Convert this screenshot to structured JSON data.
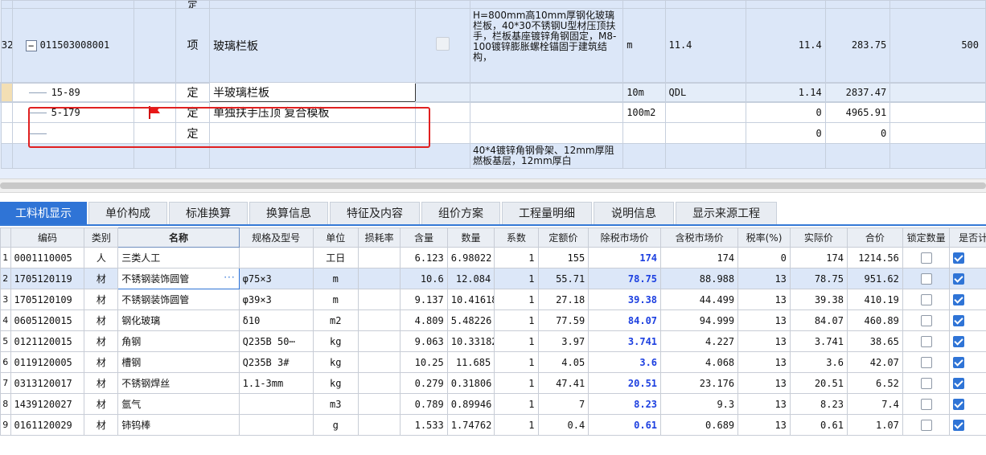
{
  "top_grid": {
    "partial_top_row": {
      "type": "定"
    },
    "main_row": {
      "rownum": "32",
      "code": "011503008001",
      "type": "项",
      "name": "玻璃栏板",
      "description": "H=800mm高10mm厚钢化玻璃栏板，40*30不锈钢U型材压顶扶手，栏板基座镀锌角钢固定，M8-100镀锌膨胀螺栓锚固于建筑结构，",
      "unit": "m",
      "qty_expr": "11.4",
      "qty": "11.4",
      "price": "283.75",
      "total": "500"
    },
    "selected_row": {
      "code": "15-89",
      "type": "定",
      "name": "半玻璃栏板",
      "unit": "10m",
      "qty_expr": "QDL",
      "qty": "1.14",
      "price": "2837.47"
    },
    "sub_rows": [
      {
        "code": "5-179",
        "type": "定",
        "name": "单独扶手压顶 复合模板",
        "unit": "100m2",
        "qty": "0",
        "price": "4965.91",
        "flagged": true
      },
      {
        "code": "",
        "type": "定",
        "name": "",
        "unit": "",
        "qty": "0",
        "price": "0",
        "flagged": false
      }
    ],
    "partial_bottom_row": {
      "description": "40*4镀锌角钢骨架、12mm厚阻燃板基层，12mm厚白"
    }
  },
  "tabs": [
    {
      "label": "工料机显示",
      "active": true
    },
    {
      "label": "单价构成",
      "active": false
    },
    {
      "label": "标准换算",
      "active": false
    },
    {
      "label": "换算信息",
      "active": false
    },
    {
      "label": "特征及内容",
      "active": false
    },
    {
      "label": "组价方案",
      "active": false
    },
    {
      "label": "工程量明细",
      "active": false
    },
    {
      "label": "说明信息",
      "active": false
    },
    {
      "label": "显示来源工程",
      "active": false
    }
  ],
  "bottom_grid": {
    "headers": [
      "编码",
      "类别",
      "名称",
      "规格及型号",
      "单位",
      "损耗率",
      "含量",
      "数量",
      "系数",
      "定额价",
      "除税市场价",
      "含税市场价",
      "税率(%)",
      "实际价",
      "合价",
      "锁定数量",
      "是否计"
    ],
    "rows": [
      {
        "rownum": "1",
        "code": "0001110005",
        "cat": "人",
        "name": "三类人工",
        "spec": "",
        "unit": "工日",
        "loss": "",
        "content": "6.123",
        "amount": "6.98022",
        "coef": "1",
        "quota": "155",
        "ex_tax": "174",
        "in_tax": "174",
        "tax": "0",
        "actual": "174",
        "total": "1214.56",
        "locked": false,
        "counted": true
      },
      {
        "rownum": "2",
        "code": "1705120119",
        "cat": "材",
        "name": "不锈钢装饰圆管",
        "spec": "φ75×3",
        "unit": "m",
        "loss": "",
        "content": "10.6",
        "amount": "12.084",
        "coef": "1",
        "quota": "55.71",
        "ex_tax": "78.75",
        "in_tax": "88.988",
        "tax": "13",
        "actual": "78.75",
        "total": "951.62",
        "locked": false,
        "counted": true,
        "selected": true
      },
      {
        "rownum": "3",
        "code": "1705120109",
        "cat": "材",
        "name": "不锈钢装饰圆管",
        "spec": "φ39×3",
        "unit": "m",
        "loss": "",
        "content": "9.137",
        "amount": "10.41618",
        "coef": "1",
        "quota": "27.18",
        "ex_tax": "39.38",
        "in_tax": "44.499",
        "tax": "13",
        "actual": "39.38",
        "total": "410.19",
        "locked": false,
        "counted": true
      },
      {
        "rownum": "4",
        "code": "0605120015",
        "cat": "材",
        "name": "钢化玻璃",
        "spec": "δ10",
        "unit": "m2",
        "loss": "",
        "content": "4.809",
        "amount": "5.48226",
        "coef": "1",
        "quota": "77.59",
        "ex_tax": "84.07",
        "in_tax": "94.999",
        "tax": "13",
        "actual": "84.07",
        "total": "460.89",
        "locked": false,
        "counted": true
      },
      {
        "rownum": "5",
        "code": "0121120015",
        "cat": "材",
        "name": "角钢",
        "spec": "Q235B 50⋯",
        "unit": "kg",
        "loss": "",
        "content": "9.063",
        "amount": "10.33182",
        "coef": "1",
        "quota": "3.97",
        "ex_tax": "3.741",
        "in_tax": "4.227",
        "tax": "13",
        "actual": "3.741",
        "total": "38.65",
        "locked": false,
        "counted": true
      },
      {
        "rownum": "6",
        "code": "0119120005",
        "cat": "材",
        "name": "槽钢",
        "spec": "Q235B 3#",
        "unit": "kg",
        "loss": "",
        "content": "10.25",
        "amount": "11.685",
        "coef": "1",
        "quota": "4.05",
        "ex_tax": "3.6",
        "in_tax": "4.068",
        "tax": "13",
        "actual": "3.6",
        "total": "42.07",
        "locked": false,
        "counted": true
      },
      {
        "rownum": "7",
        "code": "0313120017",
        "cat": "材",
        "name": "不锈钢焊丝",
        "spec": "1.1-3mm",
        "unit": "kg",
        "loss": "",
        "content": "0.279",
        "amount": "0.31806",
        "coef": "1",
        "quota": "47.41",
        "ex_tax": "20.51",
        "in_tax": "23.176",
        "tax": "13",
        "actual": "20.51",
        "total": "6.52",
        "locked": false,
        "counted": true
      },
      {
        "rownum": "8",
        "code": "1439120027",
        "cat": "材",
        "name": "氩气",
        "spec": "",
        "unit": "m3",
        "loss": "",
        "content": "0.789",
        "amount": "0.89946",
        "coef": "1",
        "quota": "7",
        "ex_tax": "8.23",
        "in_tax": "9.3",
        "tax": "13",
        "actual": "8.23",
        "total": "7.4",
        "locked": false,
        "counted": true
      },
      {
        "rownum": "9",
        "code": "0161120029",
        "cat": "材",
        "name": "铈钨棒",
        "spec": "",
        "unit": "g",
        "loss": "",
        "content": "1.533",
        "amount": "1.74762",
        "coef": "1",
        "quota": "0.4",
        "ex_tax": "0.61",
        "in_tax": "0.689",
        "tax": "13",
        "actual": "0.61",
        "total": "1.07",
        "locked": false,
        "counted": true
      }
    ]
  },
  "colors": {
    "accent": "#2f74d6",
    "highlight_box": "#e02020",
    "market_price_text": "#1c3fe0"
  }
}
